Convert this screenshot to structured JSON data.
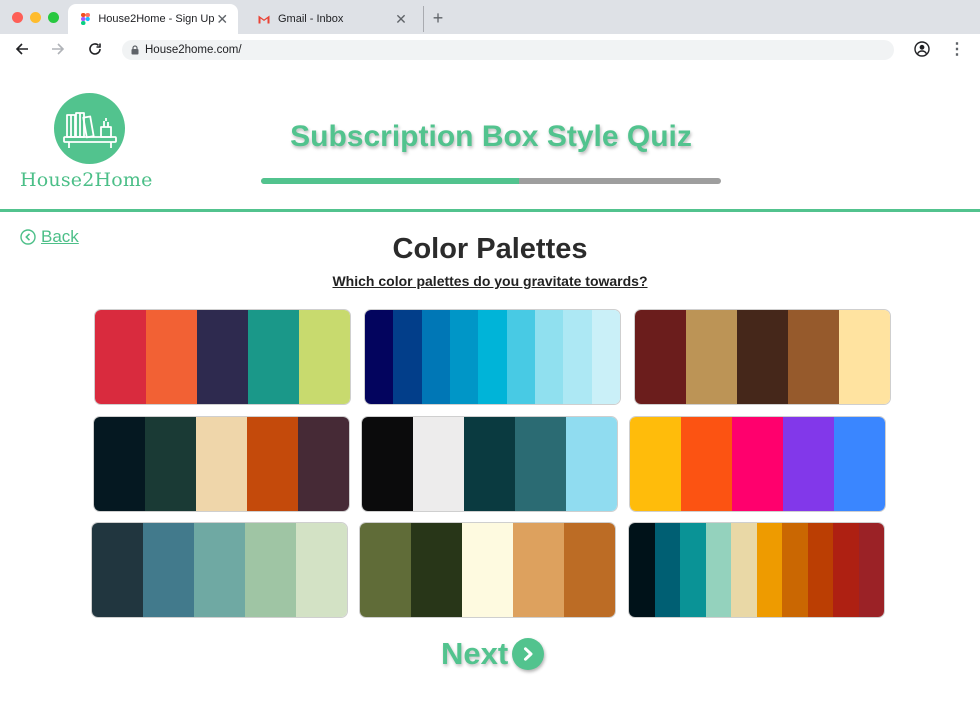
{
  "browser": {
    "tabs": [
      {
        "title": "House2Home - Sign Up",
        "active": true,
        "favicon": "figma-icon"
      },
      {
        "title": "Gmail - Inbox",
        "active": false,
        "favicon": "gmail-icon"
      }
    ],
    "url": "House2home.com/"
  },
  "header": {
    "brand": "House2Home",
    "quiz_title": "Subscription Box Style Quiz",
    "progress": 0.56
  },
  "nav": {
    "back_label": "Back",
    "next_label": "Next"
  },
  "question": {
    "title": "Color Palettes",
    "prompt": "Which color palettes do you gravitate towards?"
  },
  "palettes": [
    [
      "#d92b3e",
      "#f26134",
      "#2e2a4f",
      "#1a9889",
      "#c8da6e"
    ],
    [
      "#03045e",
      "#023e8a",
      "#0077b6",
      "#0096c7",
      "#00b4d8",
      "#48cae4",
      "#90e0ef",
      "#ade8f4",
      "#caf0f8"
    ],
    [
      "#6b1d1c",
      "#bc9456",
      "#45271a",
      "#965a2c",
      "#ffe3a0"
    ],
    [
      "#051821",
      "#1a3a35",
      "#efd6aa",
      "#c44a0b",
      "#462a36"
    ],
    [
      "#0b0b0c",
      "#edecec",
      "#0a3a40",
      "#2b6b73",
      "#90dcf0"
    ],
    [
      "#ffbc0b",
      "#fc5312",
      "#ff006d",
      "#8238ea",
      "#3a86ff"
    ],
    [
      "#21363f",
      "#427a8c",
      "#6fa9a3",
      "#9fc5a4",
      "#d3e2c5"
    ],
    [
      "#606c38",
      "#283618",
      "#fefae0",
      "#dda15e",
      "#bc6c25"
    ],
    [
      "#001219",
      "#005f73",
      "#0a9396",
      "#94d2bd",
      "#e9d8a6",
      "#ee9b00",
      "#ca6702",
      "#bb3e03",
      "#ae2012",
      "#9b2226"
    ]
  ],
  "colors": {
    "brand_green": "#52c38e",
    "progress_track": "#9e9e9e"
  }
}
